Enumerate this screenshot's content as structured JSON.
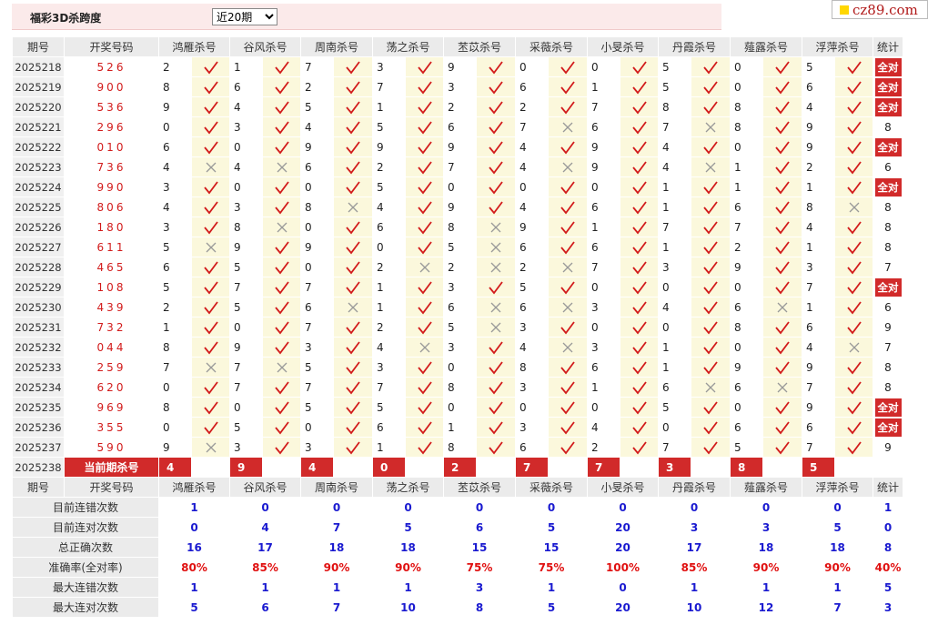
{
  "top": {
    "title": "福彩3D杀跨度",
    "select_value": "近20期"
  },
  "logo": "cz89.com",
  "headers": [
    "期号",
    "开奖号码",
    "鸿雁杀号",
    "谷风杀号",
    "周南杀号",
    "荡之杀号",
    "苤苡杀号",
    "采薇杀号",
    "小旻杀号",
    "丹霞杀号",
    "薤露杀号",
    "浮萍杀号",
    "统计"
  ],
  "rows": [
    {
      "p": "2025218",
      "n": "526",
      "c": [
        [
          "2",
          1
        ],
        [
          "1",
          1
        ],
        [
          "7",
          1
        ],
        [
          "3",
          1
        ],
        [
          "9",
          1
        ],
        [
          "0",
          1
        ],
        [
          "0",
          1
        ],
        [
          "5",
          1
        ],
        [
          "0",
          1
        ],
        [
          "5",
          1
        ]
      ],
      "t": "全对"
    },
    {
      "p": "2025219",
      "n": "900",
      "c": [
        [
          "8",
          1
        ],
        [
          "6",
          1
        ],
        [
          "2",
          1
        ],
        [
          "7",
          1
        ],
        [
          "3",
          1
        ],
        [
          "6",
          1
        ],
        [
          "1",
          1
        ],
        [
          "5",
          1
        ],
        [
          "0",
          1
        ],
        [
          "6",
          1
        ]
      ],
      "t": "全对"
    },
    {
      "p": "2025220",
      "n": "536",
      "c": [
        [
          "9",
          1
        ],
        [
          "4",
          1
        ],
        [
          "5",
          1
        ],
        [
          "1",
          1
        ],
        [
          "2",
          1
        ],
        [
          "2",
          1
        ],
        [
          "7",
          1
        ],
        [
          "8",
          1
        ],
        [
          "8",
          1
        ],
        [
          "4",
          1
        ]
      ],
      "t": "全对"
    },
    {
      "p": "2025221",
      "n": "296",
      "c": [
        [
          "0",
          1
        ],
        [
          "3",
          1
        ],
        [
          "4",
          1
        ],
        [
          "5",
          1
        ],
        [
          "6",
          1
        ],
        [
          "7",
          0
        ],
        [
          "6",
          1
        ],
        [
          "7",
          0
        ],
        [
          "8",
          1
        ],
        [
          "9",
          1
        ]
      ],
      "t": "8"
    },
    {
      "p": "2025222",
      "n": "010",
      "c": [
        [
          "6",
          1
        ],
        [
          "0",
          1
        ],
        [
          "9",
          1
        ],
        [
          "9",
          1
        ],
        [
          "9",
          1
        ],
        [
          "4",
          1
        ],
        [
          "9",
          1
        ],
        [
          "4",
          1
        ],
        [
          "0",
          1
        ],
        [
          "9",
          1
        ]
      ],
      "t": "全对"
    },
    {
      "p": "2025223",
      "n": "736",
      "c": [
        [
          "4",
          0
        ],
        [
          "4",
          0
        ],
        [
          "6",
          1
        ],
        [
          "2",
          1
        ],
        [
          "7",
          1
        ],
        [
          "4",
          0
        ],
        [
          "9",
          1
        ],
        [
          "4",
          0
        ],
        [
          "1",
          1
        ],
        [
          "2",
          1
        ]
      ],
      "t": "6"
    },
    {
      "p": "2025224",
      "n": "990",
      "c": [
        [
          "3",
          1
        ],
        [
          "0",
          1
        ],
        [
          "0",
          1
        ],
        [
          "5",
          1
        ],
        [
          "0",
          1
        ],
        [
          "0",
          1
        ],
        [
          "0",
          1
        ],
        [
          "1",
          1
        ],
        [
          "1",
          1
        ],
        [
          "1",
          1
        ]
      ],
      "t": "全对"
    },
    {
      "p": "2025225",
      "n": "806",
      "c": [
        [
          "4",
          1
        ],
        [
          "3",
          1
        ],
        [
          "8",
          0
        ],
        [
          "4",
          1
        ],
        [
          "9",
          1
        ],
        [
          "4",
          1
        ],
        [
          "6",
          1
        ],
        [
          "1",
          1
        ],
        [
          "6",
          1
        ],
        [
          "8",
          0
        ]
      ],
      "t": "8"
    },
    {
      "p": "2025226",
      "n": "180",
      "c": [
        [
          "3",
          1
        ],
        [
          "8",
          0
        ],
        [
          "0",
          1
        ],
        [
          "6",
          1
        ],
        [
          "8",
          0
        ],
        [
          "9",
          1
        ],
        [
          "1",
          1
        ],
        [
          "7",
          1
        ],
        [
          "7",
          1
        ],
        [
          "4",
          1
        ]
      ],
      "t": "8"
    },
    {
      "p": "2025227",
      "n": "611",
      "c": [
        [
          "5",
          0
        ],
        [
          "9",
          1
        ],
        [
          "9",
          1
        ],
        [
          "0",
          1
        ],
        [
          "5",
          0
        ],
        [
          "6",
          1
        ],
        [
          "6",
          1
        ],
        [
          "1",
          1
        ],
        [
          "2",
          1
        ],
        [
          "1",
          1
        ]
      ],
      "t": "8"
    },
    {
      "p": "2025228",
      "n": "465",
      "c": [
        [
          "6",
          1
        ],
        [
          "5",
          1
        ],
        [
          "0",
          1
        ],
        [
          "2",
          0
        ],
        [
          "2",
          0
        ],
        [
          "2",
          0
        ],
        [
          "7",
          1
        ],
        [
          "3",
          1
        ],
        [
          "9",
          1
        ],
        [
          "3",
          1
        ]
      ],
      "t": "7"
    },
    {
      "p": "2025229",
      "n": "108",
      "c": [
        [
          "5",
          1
        ],
        [
          "7",
          1
        ],
        [
          "7",
          1
        ],
        [
          "1",
          1
        ],
        [
          "3",
          1
        ],
        [
          "5",
          1
        ],
        [
          "0",
          1
        ],
        [
          "0",
          1
        ],
        [
          "0",
          1
        ],
        [
          "7",
          1
        ]
      ],
      "t": "全对"
    },
    {
      "p": "2025230",
      "n": "439",
      "c": [
        [
          "2",
          1
        ],
        [
          "5",
          1
        ],
        [
          "6",
          0
        ],
        [
          "1",
          1
        ],
        [
          "6",
          0
        ],
        [
          "6",
          0
        ],
        [
          "3",
          1
        ],
        [
          "4",
          1
        ],
        [
          "6",
          0
        ],
        [
          "1",
          1
        ]
      ],
      "t": "6"
    },
    {
      "p": "2025231",
      "n": "732",
      "c": [
        [
          "1",
          1
        ],
        [
          "0",
          1
        ],
        [
          "7",
          1
        ],
        [
          "2",
          1
        ],
        [
          "5",
          0
        ],
        [
          "3",
          1
        ],
        [
          "0",
          1
        ],
        [
          "0",
          1
        ],
        [
          "8",
          1
        ],
        [
          "6",
          1
        ]
      ],
      "t": "9"
    },
    {
      "p": "2025232",
      "n": "044",
      "c": [
        [
          "8",
          1
        ],
        [
          "9",
          1
        ],
        [
          "3",
          1
        ],
        [
          "4",
          0
        ],
        [
          "3",
          1
        ],
        [
          "4",
          0
        ],
        [
          "3",
          1
        ],
        [
          "1",
          1
        ],
        [
          "0",
          1
        ],
        [
          "4",
          0
        ]
      ],
      "t": "7"
    },
    {
      "p": "2025233",
      "n": "259",
      "c": [
        [
          "7",
          0
        ],
        [
          "7",
          0
        ],
        [
          "5",
          1
        ],
        [
          "3",
          1
        ],
        [
          "0",
          1
        ],
        [
          "8",
          1
        ],
        [
          "6",
          1
        ],
        [
          "1",
          1
        ],
        [
          "9",
          1
        ],
        [
          "9",
          1
        ]
      ],
      "t": "8"
    },
    {
      "p": "2025234",
      "n": "620",
      "c": [
        [
          "0",
          1
        ],
        [
          "7",
          1
        ],
        [
          "7",
          1
        ],
        [
          "7",
          1
        ],
        [
          "8",
          1
        ],
        [
          "3",
          1
        ],
        [
          "1",
          1
        ],
        [
          "6",
          0
        ],
        [
          "6",
          0
        ],
        [
          "7",
          1
        ]
      ],
      "t": "8"
    },
    {
      "p": "2025235",
      "n": "969",
      "c": [
        [
          "8",
          1
        ],
        [
          "0",
          1
        ],
        [
          "5",
          1
        ],
        [
          "5",
          1
        ],
        [
          "0",
          1
        ],
        [
          "0",
          1
        ],
        [
          "0",
          1
        ],
        [
          "5",
          1
        ],
        [
          "0",
          1
        ],
        [
          "9",
          1
        ]
      ],
      "t": "全对"
    },
    {
      "p": "2025236",
      "n": "355",
      "c": [
        [
          "0",
          1
        ],
        [
          "5",
          1
        ],
        [
          "0",
          1
        ],
        [
          "6",
          1
        ],
        [
          "1",
          1
        ],
        [
          "3",
          1
        ],
        [
          "4",
          1
        ],
        [
          "0",
          1
        ],
        [
          "6",
          1
        ],
        [
          "6",
          1
        ]
      ],
      "t": "全对"
    },
    {
      "p": "2025237",
      "n": "590",
      "c": [
        [
          "9",
          0
        ],
        [
          "3",
          1
        ],
        [
          "3",
          1
        ],
        [
          "1",
          1
        ],
        [
          "8",
          1
        ],
        [
          "6",
          1
        ],
        [
          "2",
          1
        ],
        [
          "7",
          1
        ],
        [
          "5",
          1
        ],
        [
          "7",
          1
        ]
      ],
      "t": "9"
    }
  ],
  "current": {
    "p": "2025238",
    "label": "当前期杀号",
    "picks": [
      "4",
      "9",
      "4",
      "0",
      "2",
      "7",
      "7",
      "3",
      "8",
      "5"
    ]
  },
  "stats": [
    {
      "label": "目前连错次数",
      "vals": [
        "1",
        "0",
        "0",
        "0",
        "0",
        "0",
        "0",
        "0",
        "0",
        "0",
        "1"
      ]
    },
    {
      "label": "目前连对次数",
      "vals": [
        "0",
        "4",
        "7",
        "5",
        "6",
        "5",
        "20",
        "3",
        "3",
        "5",
        "0"
      ]
    },
    {
      "label": "总正确次数",
      "vals": [
        "16",
        "17",
        "18",
        "18",
        "15",
        "15",
        "20",
        "17",
        "18",
        "18",
        "8"
      ]
    },
    {
      "label": "准确率(全对率)",
      "vals": [
        "80%",
        "85%",
        "90%",
        "90%",
        "75%",
        "75%",
        "100%",
        "85%",
        "90%",
        "90%",
        "40%"
      ],
      "accent": true
    },
    {
      "label": "最大连错次数",
      "vals": [
        "1",
        "1",
        "1",
        "1",
        "3",
        "1",
        "0",
        "1",
        "1",
        "1",
        "5"
      ]
    },
    {
      "label": "最大连对次数",
      "vals": [
        "5",
        "6",
        "7",
        "10",
        "8",
        "5",
        "20",
        "10",
        "12",
        "7",
        "3"
      ]
    }
  ],
  "colors": {
    "red": "#d12a2a",
    "blue": "#1a1ad0",
    "mark_bg": "#fbf8dc"
  }
}
